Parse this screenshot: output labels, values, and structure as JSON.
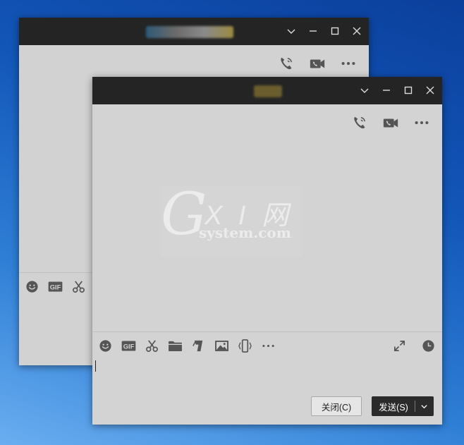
{
  "back_window": {
    "title": "",
    "controls": [
      "chevron-down-icon",
      "minimize-icon",
      "maximize-icon",
      "close-icon"
    ]
  },
  "front_window": {
    "title": "",
    "controls": [
      "chevron-down-icon",
      "minimize-icon",
      "maximize-icon",
      "close-icon"
    ],
    "top_actions": [
      "voice-call-icon",
      "video-call-icon",
      "more-icon"
    ],
    "toolbar_left": [
      "emoji-icon",
      "gif-icon",
      "screenshot-scissors-icon",
      "folder-icon",
      "shake-icon",
      "image-icon",
      "phone-shake-icon",
      "more-icon"
    ],
    "toolbar_right": [
      "expand-icon",
      "history-clock-icon"
    ],
    "input_value": "",
    "buttons": {
      "close_label": "关闭(C)",
      "send_label": "发送(S)"
    }
  },
  "watermark": {
    "big_letter": "G",
    "brand": "X I 网",
    "domain": "system.com"
  },
  "colors": {
    "titlebar": "#242424",
    "window_bg": "#d3d3d3",
    "icon": "#555555",
    "send_button": "#2b2b2b"
  }
}
